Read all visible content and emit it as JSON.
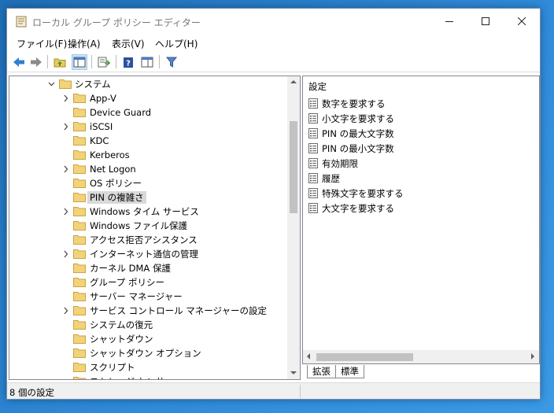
{
  "window": {
    "title": "ローカル グループ ポリシー エディター"
  },
  "menu": [
    "ファイル(F)",
    "操作(A)",
    "表示(V)",
    "ヘルプ(H)"
  ],
  "tree": {
    "root": {
      "label": "システム",
      "expanded": true
    },
    "items": [
      {
        "label": "App-V",
        "expandable": true
      },
      {
        "label": "Device Guard",
        "expandable": false
      },
      {
        "label": "iSCSI",
        "expandable": true
      },
      {
        "label": "KDC",
        "expandable": false
      },
      {
        "label": "Kerberos",
        "expandable": false
      },
      {
        "label": "Net Logon",
        "expandable": true
      },
      {
        "label": "OS ポリシー",
        "expandable": false
      },
      {
        "label": "PIN の複雑さ",
        "expandable": false,
        "selected": true
      },
      {
        "label": "Windows タイム サービス",
        "expandable": true
      },
      {
        "label": "Windows ファイル保護",
        "expandable": false
      },
      {
        "label": "アクセス拒否アシスタンス",
        "expandable": false
      },
      {
        "label": "インターネット通信の管理",
        "expandable": true
      },
      {
        "label": "カーネル DMA 保護",
        "expandable": false
      },
      {
        "label": "グループ ポリシー",
        "expandable": false
      },
      {
        "label": "サーバー マネージャー",
        "expandable": false
      },
      {
        "label": "サービス コントロール マネージャーの設定",
        "expandable": true
      },
      {
        "label": "システムの復元",
        "expandable": false
      },
      {
        "label": "シャットダウン",
        "expandable": false
      },
      {
        "label": "シャットダウン オプション",
        "expandable": false
      },
      {
        "label": "スクリプト",
        "expandable": false
      },
      {
        "label": "ストレージ センサー",
        "expandable": false
      }
    ]
  },
  "list": {
    "header": "設定",
    "items": [
      "数字を要求する",
      "小文字を要求する",
      "PIN の最大文字数",
      "PIN の最小文字数",
      "有効期限",
      "履歴",
      "特殊文字を要求する",
      "大文字を要求する"
    ]
  },
  "tabs": [
    "拡張",
    "標準"
  ],
  "status": {
    "text": "8 個の設定"
  }
}
